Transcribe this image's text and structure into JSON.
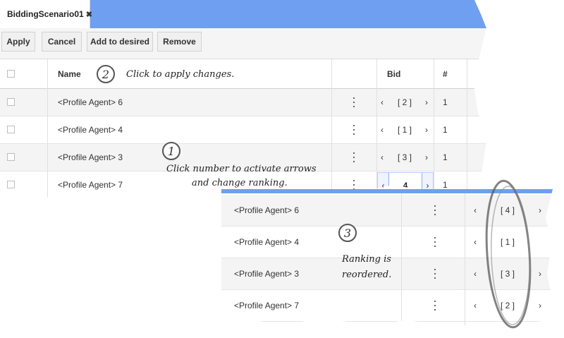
{
  "tab": {
    "title": "BiddingScenario01",
    "close_glyph": "✖"
  },
  "toolbar": {
    "buttons": [
      "Apply",
      "Cancel",
      "Add to desired",
      "Remove"
    ]
  },
  "grid": {
    "headers": {
      "name": "Name",
      "bid": "Bid",
      "count": "#"
    },
    "rows": [
      {
        "name": "<Profile Agent> 6",
        "rank": "[ 2 ]",
        "count": "1"
      },
      {
        "name": "<Profile Agent> 4",
        "rank": "[ 1 ]",
        "count": "1"
      },
      {
        "name": "<Profile Agent> 3",
        "rank": "[ 3 ]",
        "count": "1"
      },
      {
        "name": "<Profile Agent> 7",
        "rank": "4",
        "count": "1",
        "active": true
      }
    ],
    "arrow_left": "‹",
    "arrow_right": "›"
  },
  "reordered": {
    "rows": [
      {
        "name": "<Profile Agent> 6",
        "rank": "[ 4 ]"
      },
      {
        "name": "<Profile Agent> 4",
        "rank": "[ 1 ]"
      },
      {
        "name": "<Profile Agent> 3",
        "rank": "[ 3 ]"
      },
      {
        "name": "<Profile Agent> 7",
        "rank": "[ 2 ]"
      }
    ]
  },
  "annotations": {
    "step1": {
      "number": "1",
      "line1": "Click number to activate arrows",
      "line2": "and change ranking."
    },
    "step2": {
      "number": "2",
      "text": "Click to apply changes."
    },
    "step3": {
      "number": "3",
      "line1": "Ranking is",
      "line2": "reordered."
    }
  }
}
